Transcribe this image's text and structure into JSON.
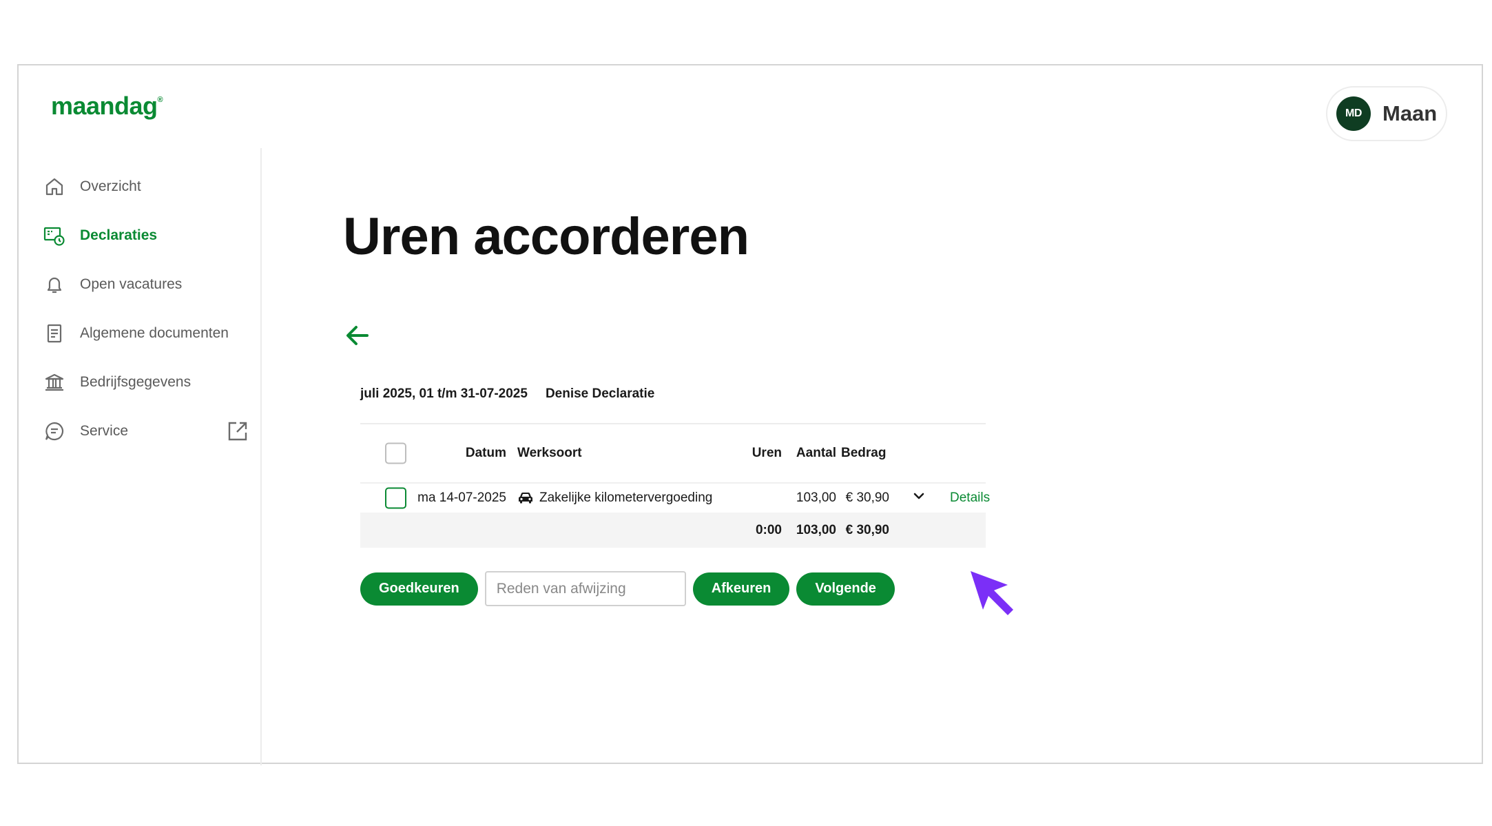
{
  "brand": {
    "logo_text": "maandag",
    "logo_mark": "®",
    "color": "#0a8a33"
  },
  "user": {
    "initials": "MD",
    "name": "Maan"
  },
  "sidebar": {
    "items": [
      {
        "label": "Overzicht",
        "icon": "home-icon",
        "active": false
      },
      {
        "label": "Declaraties",
        "icon": "receipt-clock-icon",
        "active": true
      },
      {
        "label": "Open vacatures",
        "icon": "bell-icon",
        "active": false
      },
      {
        "label": "Algemene documenten",
        "icon": "document-icon",
        "active": false
      },
      {
        "label": "Bedrijfsgegevens",
        "icon": "bank-icon",
        "active": false
      },
      {
        "label": "Service",
        "icon": "chat-icon",
        "active": false,
        "external_icon": "external-link-icon"
      }
    ]
  },
  "main": {
    "title": "Uren accorderen",
    "period": "juli 2025, 01 t/m 31-07-2025",
    "declaration_name": "Denise Declaratie",
    "table": {
      "headers": {
        "datum": "Datum",
        "werksoort": "Werksoort",
        "uren": "Uren",
        "aantal": "Aantal",
        "bedrag": "Bedrag"
      },
      "rows": [
        {
          "datum": "ma 14-07-2025",
          "werksoort": "Zakelijke kilometervergoeding",
          "werksoort_icon": "car-icon",
          "uren": "",
          "aantal": "103,00",
          "bedrag": "€ 30,90",
          "details": "Details"
        }
      ],
      "totals": {
        "uren": "0:00",
        "aantal": "103,00",
        "bedrag": "€ 30,90"
      }
    },
    "actions": {
      "approve_label": "Goedkeuren",
      "reason_placeholder": "Reden van afwijzing",
      "reject_label": "Afkeuren",
      "next_label": "Volgende"
    }
  }
}
